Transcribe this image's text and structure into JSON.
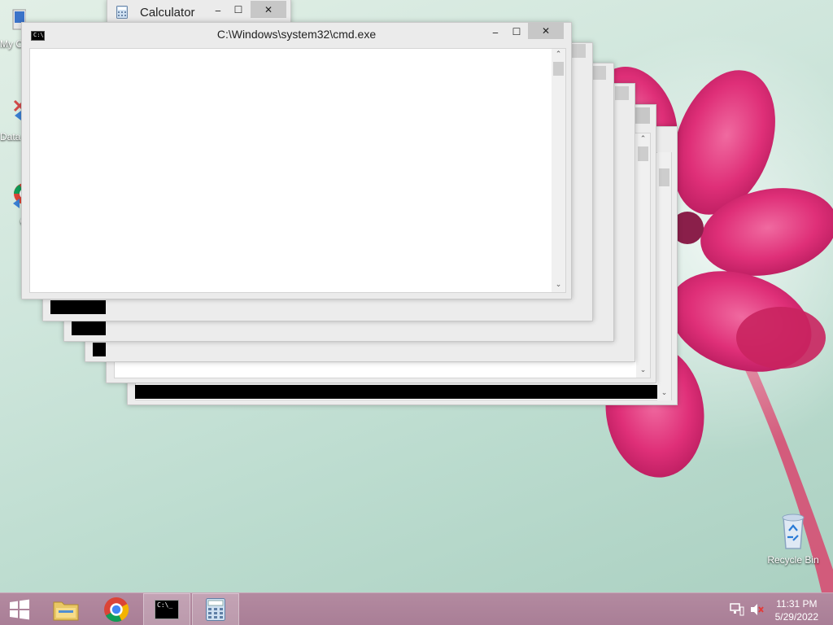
{
  "colors": {
    "taskbar": "#ab8098",
    "wallpaper_bg": "#c3e0d4",
    "flower": "#e0337a",
    "close_button": "#c7c7c7"
  },
  "desktop": {
    "icons": [
      {
        "name": "my-computer-icon",
        "label": "My C"
      },
      {
        "name": "data-icon",
        "label": "Data"
      },
      {
        "name": "chrome-desktop-icon",
        "label": "G"
      },
      {
        "name": "recycle-bin-icon",
        "label": "Recycle Bin"
      }
    ]
  },
  "windows": {
    "cmd_main": {
      "title": "C:\\Windows\\system32\\cmd.exe",
      "icon": "cmd-icon",
      "minimize": "‒",
      "maximize": "☐",
      "close": "✕"
    },
    "calculator": {
      "title": "Calculator",
      "icon": "calculator-icon",
      "minimize": "‒",
      "maximize": "☐",
      "close": "✕"
    },
    "cmd_stack": {
      "maximize": "☐",
      "close": "✕"
    }
  },
  "taskbar": {
    "start": "start-icon",
    "pinned": [
      "file-explorer-icon",
      "chrome-icon",
      "cmd-icon",
      "calculator-icon"
    ],
    "tray": [
      "network-icon",
      "volume-muted-icon"
    ],
    "time": "11:31 PM",
    "date": "5/29/2022"
  }
}
